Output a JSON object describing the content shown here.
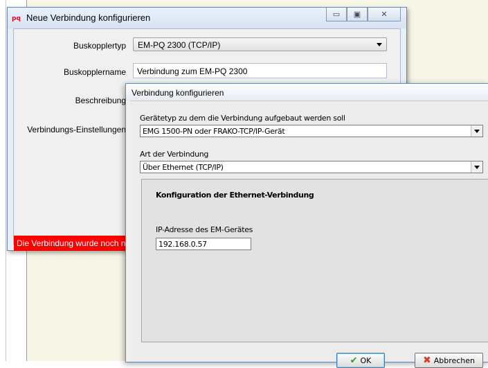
{
  "back_window": {
    "title": "Neue Verbindung konfigurieren",
    "labels": {
      "buskopplertyp": "Buskopplertyp",
      "buskopplername": "Buskopplername",
      "beschreibung": "Beschreibung",
      "verbindungs_einstellungen": "Verbindungs-Einstellungen"
    },
    "buskopplertyp_value": "EM-PQ 2300 (TCP/IP)",
    "buskopplername_value": "Verbindung zum EM-PQ 2300",
    "status_text": "Die Verbindung wurde noch n",
    "status_color": "#ff0000"
  },
  "dialog": {
    "title": "Verbindung konfigurieren",
    "geraetetyp_label": "Gerätetyp zu dem die Verbindung aufgebaut werden soll",
    "geraetetyp_value": "EMG 1500-PN oder FRAKO-TCP/IP-Gerät",
    "art_label": "Art der Verbindung",
    "art_value": "Über Ethernet (TCP/IP)",
    "panel_title": "Konfiguration der Ethernet-Verbindung",
    "ip_label": "IP-Adresse des EM-Gerätes",
    "ip_value": "192.168.0.57",
    "ok_label": "OK",
    "cancel_label": "Abbrechen"
  }
}
